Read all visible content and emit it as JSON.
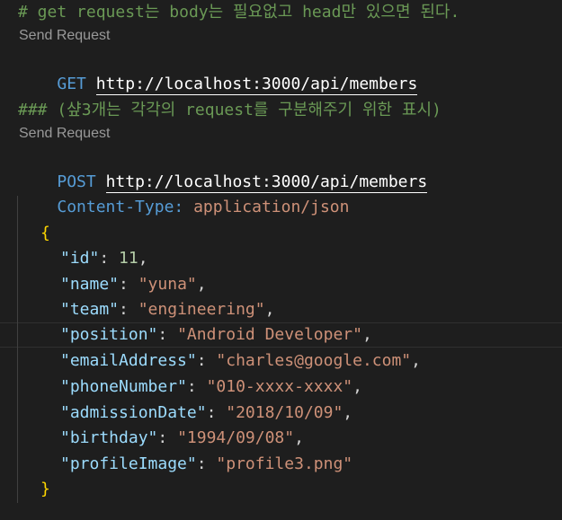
{
  "editor": {
    "comment1": "# get request는 body는 필요없고 head만 있으면 된다.",
    "request1": {
      "codelens": "Send Request",
      "method": "GET",
      "url": "http://localhost:3000/api/members"
    },
    "comment2": "### (샾3개는 각각의 request를 구분해주기 위한 표시)",
    "request2": {
      "codelens": "Send Request",
      "method": "POST",
      "url": "http://localhost:3000/api/members",
      "header_name": "Content-Type:",
      "header_value": "application/json"
    },
    "body": {
      "open_brace": "{",
      "close_brace": "}",
      "fields": [
        {
          "key": "\"id\"",
          "value": "11",
          "kind": "number",
          "comma": ","
        },
        {
          "key": "\"name\"",
          "value": "\"yuna\"",
          "kind": "string",
          "comma": ","
        },
        {
          "key": "\"team\"",
          "value": "\"engineering\"",
          "kind": "string",
          "comma": ","
        },
        {
          "key": "\"position\"",
          "value": "\"Android Developer\"",
          "kind": "string",
          "comma": ","
        },
        {
          "key": "\"emailAddress\"",
          "value": "\"charles@google.com\"",
          "kind": "string",
          "comma": ","
        },
        {
          "key": "\"phoneNumber\"",
          "value": "\"010-xxxx-xxxx\"",
          "kind": "string",
          "comma": ","
        },
        {
          "key": "\"admissionDate\"",
          "value": "\"2018/10/09\"",
          "kind": "string",
          "comma": ","
        },
        {
          "key": "\"birthday\"",
          "value": "\"1994/09/08\"",
          "kind": "string",
          "comma": ","
        },
        {
          "key": "\"profileImage\"",
          "value": "\"profile3.png\"",
          "kind": "string",
          "comma": ""
        }
      ]
    },
    "colors": {
      "background": "#1e1e1e",
      "comment": "#6a9955",
      "keyword": "#569cd6",
      "string": "#ce9178",
      "json_key": "#9cdcfe",
      "number": "#b5cea8",
      "brace": "#ffd700",
      "codelens": "#999999"
    }
  }
}
